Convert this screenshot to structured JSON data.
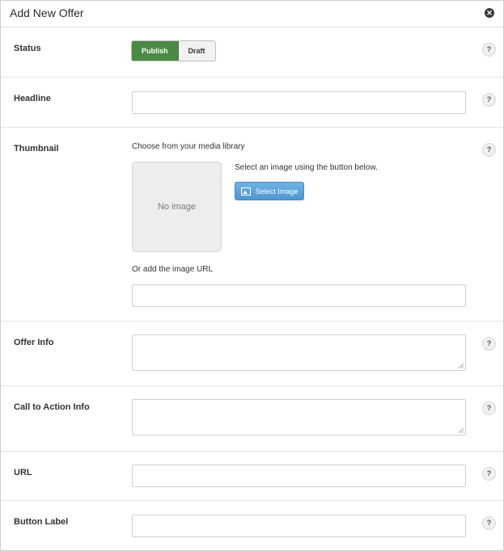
{
  "dialog": {
    "title": "Add New Offer",
    "help_symbol": "?"
  },
  "status": {
    "label": "Status",
    "options": [
      "Publish",
      "Draft"
    ],
    "selected": "Publish"
  },
  "headline": {
    "label": "Headline",
    "value": ""
  },
  "thumbnail": {
    "label": "Thumbnail",
    "library_text": "Choose from your media library",
    "placeholder_text": "No image",
    "select_hint": "Select an image using the button below.",
    "select_button": "Select Image",
    "url_label": "Or add the image URL",
    "url_value": ""
  },
  "offer_info": {
    "label": "Offer Info",
    "value": ""
  },
  "cta_info": {
    "label": "Call to Action Info",
    "value": ""
  },
  "url": {
    "label": "URL",
    "value": ""
  },
  "button_label": {
    "label": "Button Label",
    "value": ""
  },
  "colors": {
    "publish_active": "#4a8a45",
    "select_button": "#5aa0d8"
  }
}
